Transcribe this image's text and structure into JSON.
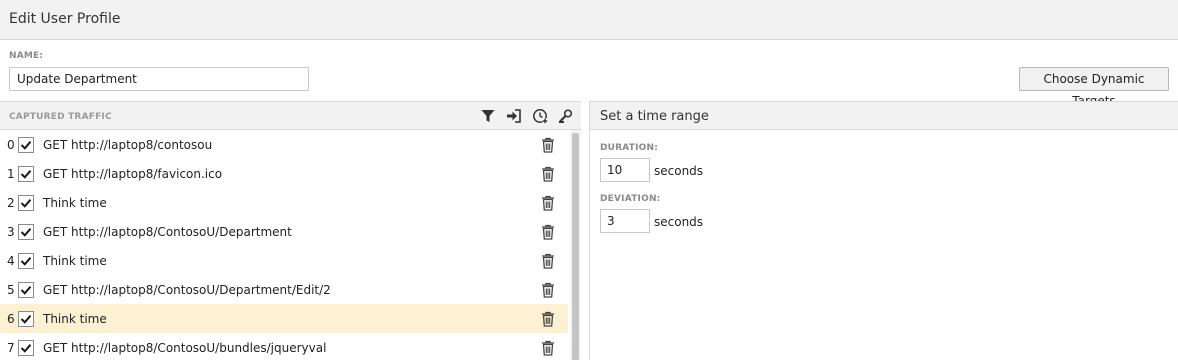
{
  "window": {
    "title": "Edit User Profile"
  },
  "profile": {
    "name_label": "NAME:",
    "name_value": "Update Department",
    "dynamic_targets_button": "Choose Dynamic Targets"
  },
  "captured_traffic": {
    "header": "CAPTURED TRAFFIC",
    "toolbar_icons": [
      "filter-icon",
      "sign-in-icon",
      "clock-add-icon",
      "search-user-icon"
    ],
    "items": [
      {
        "index": "0",
        "checked": true,
        "text": "GET http://laptop8/contosou",
        "selected": false
      },
      {
        "index": "1",
        "checked": true,
        "text": "GET http://laptop8/favicon.ico",
        "selected": false
      },
      {
        "index": "2",
        "checked": true,
        "text": "Think time",
        "selected": false
      },
      {
        "index": "3",
        "checked": true,
        "text": "GET http://laptop8/ContosoU/Department",
        "selected": false
      },
      {
        "index": "4",
        "checked": true,
        "text": "Think time",
        "selected": false
      },
      {
        "index": "5",
        "checked": true,
        "text": "GET http://laptop8/ContosoU/Department/Edit/2",
        "selected": false
      },
      {
        "index": "6",
        "checked": true,
        "text": "Think time",
        "selected": true
      },
      {
        "index": "7",
        "checked": true,
        "text": "GET http://laptop8/ContosoU/bundles/jqueryval",
        "selected": false
      }
    ]
  },
  "time_range": {
    "title": "Set a time range",
    "duration_label": "DURATION:",
    "duration_value": "10",
    "duration_unit": "seconds",
    "deviation_label": "DEVIATION:",
    "deviation_value": "3",
    "deviation_unit": "seconds"
  },
  "colors": {
    "selected_row": "#fdf1d3",
    "header_bg": "#f2f2f2"
  }
}
